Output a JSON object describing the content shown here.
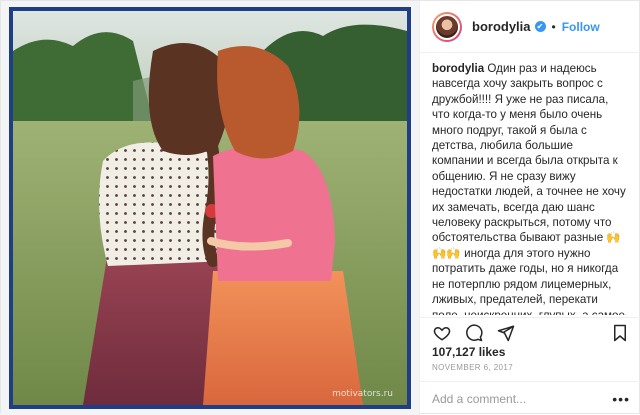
{
  "post": {
    "username": "borodylia",
    "verified_mark": "✔",
    "separator": "•",
    "follow_label": "Follow",
    "caption_user": "borodylia",
    "caption_text": "Один раз и надеюсь навсегда хочу закрыть вопрос с дружбой!!!! Я уже не раз писала, что когда-то у меня было очень много подруг, такой я была с детства, любила большие компании и всегда была открыта к общению. Я не сразу вижу недостатки людей, а точнее не хочу их замечать, всегда даю шанс человеку раскрыться, потому что обстоятельства бывают разные 🙌🙌🙌 иногда для этого нужно потратить даже годы, но я никогда не потерплю рядом лицемерных, лживых, предателей, перекати поле, неискренних, глупых, а самое главное людей , у которых кроме выгоды в глазах и сердце ничего нет. Пустышки!!!! Кроме жалости, ничего испытывать к них не хочу и не умею((( Я сама всегда отдам последнее близкому это знают все мои, я всегда протяну руку",
    "likes": "107,127 likes",
    "date": "NOVEMBER 6, 2017",
    "comment_placeholder": "Add a comment...",
    "more_label": "•••",
    "watermark": "motivators.ru"
  },
  "icons": {
    "like": "heart-icon",
    "comment": "comment-bubble-icon",
    "share": "share-arrow-icon",
    "save": "bookmark-icon",
    "verified": "verified-badge-icon"
  },
  "colors": {
    "link_blue": "#3897f0",
    "frame_blue": "#1f3e86"
  }
}
